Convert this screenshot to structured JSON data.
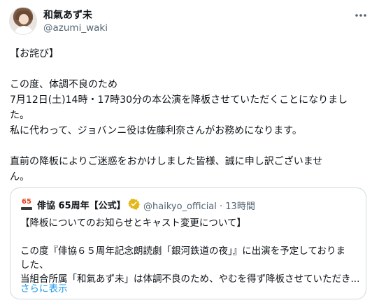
{
  "author": {
    "display_name": "和氣あず未",
    "handle": "@azumi_waki"
  },
  "icons": {
    "more": "more-horizontal-icon",
    "verified": "verified-badge-icon",
    "logo": "haikyo-65th-logo-icon"
  },
  "colors": {
    "link": "#1d9bf0",
    "verified_gold": "#e2b719",
    "secondary_text": "#536471",
    "border": "#cfd9de"
  },
  "tweet": {
    "lines": [
      "【お詫び】",
      "",
      "この度、体調不良のため",
      "7月12日(土)14時・17時30分の本公演を降板させていただくことになりまし",
      "た。",
      "私に代わって、ジョバンニ役は佐藤利奈さんがお務めになります。",
      "",
      "直前の降板によりご迷惑をおかけしました皆様、誠に申し訳ございませ",
      "ん。"
    ]
  },
  "quote": {
    "logo_text": "65",
    "display_name": "俳協 65周年【公式】",
    "handle_time": "@haikyo_official · 13時間",
    "lines": [
      "【降板についてのお知らせとキャスト変更について】",
      "",
      "この度『俳協６５周年記念朗読劇「銀河鉄道の夜」』に出演を予定しておりま",
      "した、",
      "当組合所属「和氣あず未」は体調不良のため、やむを得ず降板させていただき..."
    ],
    "show_more": "さらに表示"
  }
}
